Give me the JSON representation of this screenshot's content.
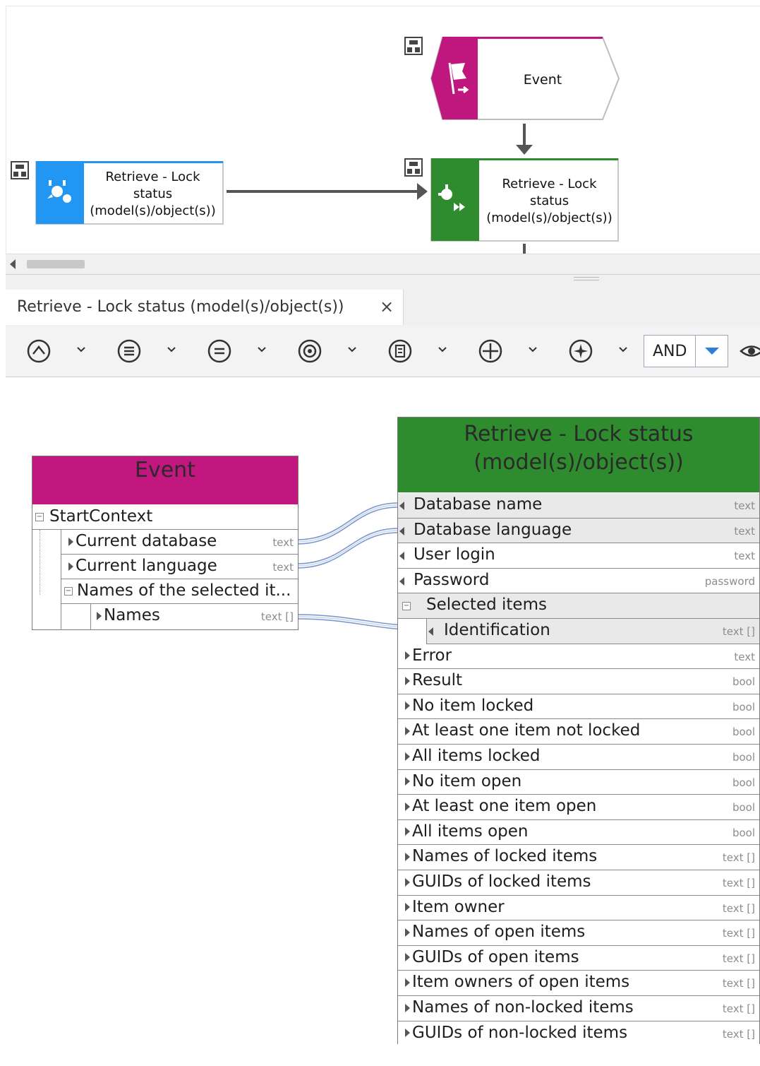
{
  "canvas": {
    "event_node": {
      "label": "Event",
      "color": "#c0177f"
    },
    "source_node": {
      "label_lines": [
        "Retrieve - Lock",
        "status",
        "(model(s)/object(s))"
      ],
      "color": "#2196f3"
    },
    "target_node": {
      "label_lines": [
        "Retrieve - Lock",
        "status",
        "(model(s)/object(s))"
      ],
      "color": "#2e8b2e"
    }
  },
  "tab": {
    "title": "Retrieve - Lock status (model(s)/object(s))",
    "close": "×"
  },
  "toolbar": {
    "icons": [
      "collapse-circle-icon",
      "list-circle-icon",
      "equals-circle-icon",
      "target-circle-icon",
      "document-circle-icon",
      "plus-circle-icon",
      "sparkle-circle-icon"
    ],
    "operator": "AND",
    "view_icon": "eye-icon"
  },
  "event_box": {
    "title": "Event",
    "header_color": "#c2177f",
    "root": "StartContext",
    "items": [
      {
        "label": "Current database",
        "type": "text"
      },
      {
        "label": "Current language",
        "type": "text"
      },
      {
        "label": "Names of the selected it...",
        "type": ""
      },
      {
        "label": "Names",
        "type": "text []"
      }
    ]
  },
  "function_box": {
    "title_lines": [
      "Retrieve - Lock status",
      "(model(s)/object(s))"
    ],
    "header_color": "#2e8b2e",
    "inputs": [
      {
        "label": "Database name",
        "type": "text"
      },
      {
        "label": "Database language",
        "type": "text"
      },
      {
        "label": "User login",
        "type": "text"
      },
      {
        "label": "Password",
        "type": "password"
      },
      {
        "label": "Selected items",
        "type": ""
      },
      {
        "label": "Identification",
        "type": "text []"
      }
    ],
    "outputs": [
      {
        "label": "Error",
        "type": "text"
      },
      {
        "label": "Result",
        "type": "bool"
      },
      {
        "label": "No item locked",
        "type": "bool"
      },
      {
        "label": "At least one item not locked",
        "type": "bool"
      },
      {
        "label": "All items locked",
        "type": "bool"
      },
      {
        "label": "No item open",
        "type": "bool"
      },
      {
        "label": "At least one item open",
        "type": "bool"
      },
      {
        "label": "All items open",
        "type": "bool"
      },
      {
        "label": "Names of locked items",
        "type": "text []"
      },
      {
        "label": "GUIDs of locked items",
        "type": "text []"
      },
      {
        "label": "Item owner",
        "type": "text []"
      },
      {
        "label": "Names of open items",
        "type": "text []"
      },
      {
        "label": "GUIDs of open items",
        "type": "text []"
      },
      {
        "label": "Item owners of open items",
        "type": "text []"
      },
      {
        "label": "Names of non-locked items",
        "type": "text []"
      },
      {
        "label": "GUIDs of non-locked items",
        "type": "text []"
      }
    ]
  }
}
